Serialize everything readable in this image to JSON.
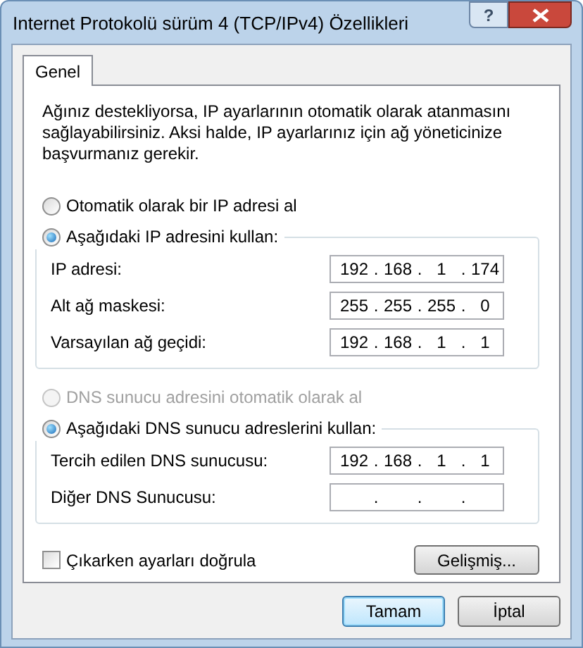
{
  "window": {
    "title": "Internet Protokolü sürüm 4 (TCP/IPv4) Özellikleri",
    "help": "?"
  },
  "tabs": [
    {
      "label": "Genel",
      "selected": true
    }
  ],
  "description": "Ağınız destekliyorsa, IP ayarlarının otomatik olarak atanmasını sağlayabilirsiniz. Aksi halde, IP ayarlarınız için ağ yöneticinize başvurmanız gerekir.",
  "ip_section": {
    "options": [
      {
        "label": "Otomatik olarak bir IP adresi al",
        "selected": false,
        "disabled": false
      },
      {
        "label": "Aşağıdaki IP adresini kullan:",
        "selected": true,
        "disabled": false
      }
    ],
    "fields": [
      {
        "label": "IP adresi:",
        "octets": [
          "192",
          "168",
          "1",
          "174"
        ],
        "separators": [
          ".",
          ".",
          "."
        ]
      },
      {
        "label": "Alt ağ maskesi:",
        "octets": [
          "255",
          "255",
          "255",
          "0"
        ],
        "separators": [
          ".",
          ".",
          "."
        ]
      },
      {
        "label": "Varsayılan ağ geçidi:",
        "octets": [
          "192",
          "168",
          "1",
          "1"
        ],
        "separators": [
          ".",
          ".",
          "."
        ]
      }
    ]
  },
  "dns_section": {
    "options": [
      {
        "label": "DNS sunucu adresini otomatik olarak al",
        "selected": false,
        "disabled": true
      },
      {
        "label": "Aşağıdaki DNS sunucu adreslerini kullan:",
        "selected": true,
        "disabled": false
      }
    ],
    "fields": [
      {
        "label": "Tercih edilen DNS sunucusu:",
        "octets": [
          "192",
          "168",
          "1",
          "1"
        ],
        "separators": [
          ".",
          ".",
          "."
        ]
      },
      {
        "label": "Diğer DNS Sunucusu:",
        "separators": [
          ".",
          ".",
          "."
        ]
      }
    ]
  },
  "checkbox": {
    "label": "Çıkarken ayarları doğrula",
    "checked": false
  },
  "advanced_button": "Gelişmiş...",
  "buttons": [
    {
      "label": "Tamam",
      "default": true
    },
    {
      "label": "İptal",
      "default": false
    }
  ]
}
